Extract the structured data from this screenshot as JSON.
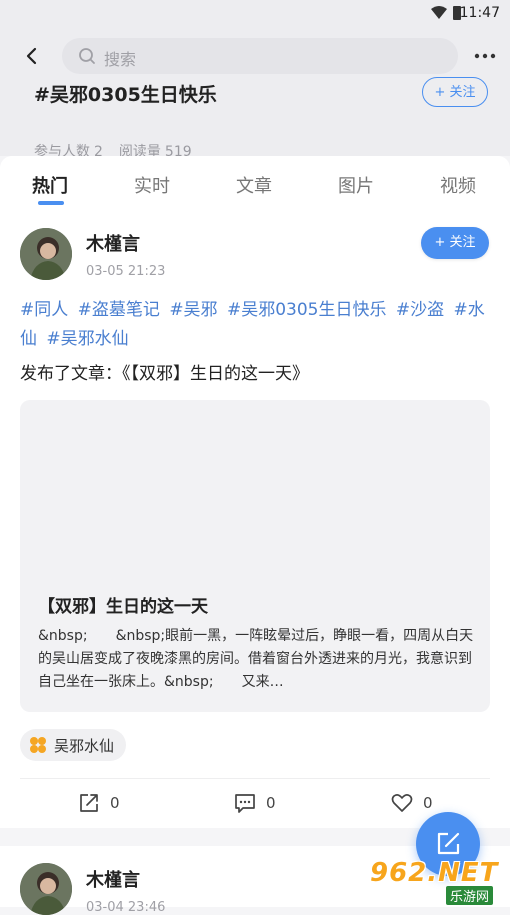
{
  "status": {
    "time": "11:47"
  },
  "search": {
    "placeholder": "搜索"
  },
  "topic": {
    "title": "#吴邪0305生日快乐",
    "follow_label": "+ 关注",
    "participants_label": "参与人数",
    "participants": "2",
    "reads_label": "阅读量",
    "reads": "519"
  },
  "tabs": [
    "热门",
    "实时",
    "文章",
    "图片",
    "视频"
  ],
  "post": {
    "author": "木槿言",
    "time": "03-05 21:23",
    "follow_label": "+ 关注",
    "tags": [
      "#同人",
      "#盗墓笔记",
      "#吴邪",
      "#吴邪0305生日快乐",
      "#沙盗",
      "#水仙",
      "#吴邪水仙"
    ],
    "text": "发布了文章：《【双邪】生日的这一天》",
    "article": {
      "title": "【双邪】生日的这一天",
      "excerpt": "&nbsp;　　&nbsp;眼前一黑，一阵眩晕过后，睁眼一看，四周从白天的吴山居变成了夜晚漆黑的房间。借着窗台外透进来的月光，我意识到自己坐在一张床上。&nbsp;　　又来…"
    },
    "circle": "吴邪水仙",
    "shares": "0",
    "comments": "0",
    "likes": "0"
  },
  "post2": {
    "author": "木槿言",
    "time": "03-04 23:46"
  },
  "watermark": {
    "main": "962.NET",
    "sub": "乐游网"
  },
  "colors": {
    "accent": "#4a8ff0",
    "tag": "#4a7fd0",
    "header_bg": "#ededf0"
  }
}
